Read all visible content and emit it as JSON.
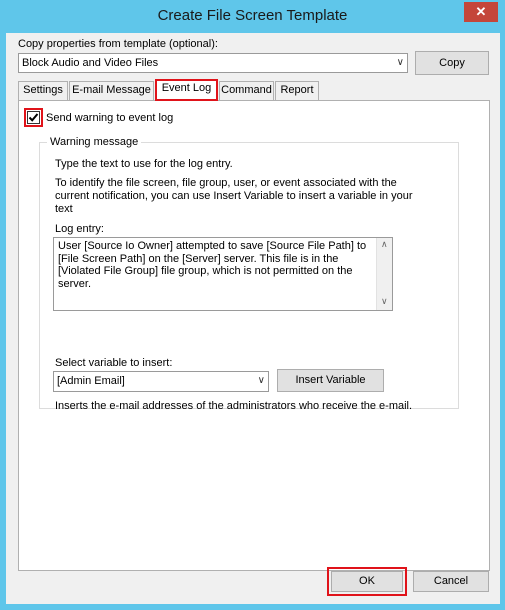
{
  "window": {
    "title": "Create File Screen Template",
    "close_glyph": "✕"
  },
  "copy_from": {
    "label": "Copy properties from template (optional):",
    "selected": "Block Audio and Video Files",
    "copy_button": "Copy"
  },
  "tabs": [
    {
      "label": "Settings",
      "active": false
    },
    {
      "label": "E-mail Message",
      "active": false
    },
    {
      "label": "Event Log",
      "active": true
    },
    {
      "label": "Command",
      "active": false
    },
    {
      "label": "Report",
      "active": false
    }
  ],
  "event_log": {
    "send_warning_label": "Send warning to event log",
    "send_warning_checked": true,
    "group_title": "Warning message",
    "instructions_1": "Type the text to use for the log entry.",
    "instructions_2": "To identify the file screen, file group, user, or event associated with the current notification, you can use Insert Variable to insert a variable in your text",
    "log_entry_label": "Log entry:",
    "log_entry_text": "User [Source Io Owner] attempted to save [Source File Path] to [File Screen Path] on the [Server] server. This file is in the [Violated File Group] file group, which is not permitted on the server.",
    "variable_label": "Select variable to insert:",
    "variable_selected": "[Admin Email]",
    "insert_button": "Insert Variable",
    "variable_description": "Inserts the e-mail addresses of the administrators who receive the e-mail."
  },
  "footer": {
    "ok": "OK",
    "cancel": "Cancel"
  },
  "colors": {
    "highlight": "#e0131a",
    "titlebar": "#5fc6ea",
    "close": "#c4463a"
  }
}
